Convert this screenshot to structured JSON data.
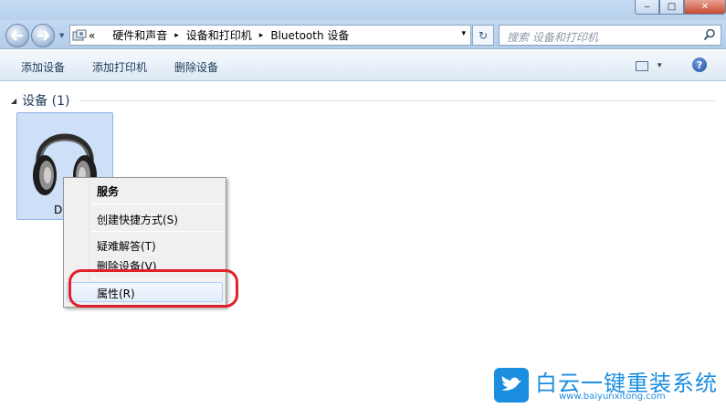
{
  "titlebar": {
    "min_label": "‒",
    "max_label": "□",
    "close_label": "✕"
  },
  "address": {
    "overflow": "«",
    "crumbs": [
      "硬件和声音",
      "设备和打印机",
      "Bluetooth 设备"
    ],
    "separator": "▸",
    "dropdown": "▾",
    "refresh": "↻"
  },
  "search": {
    "placeholder": "搜索 设备和打印机"
  },
  "commands": {
    "add_device": "添加设备",
    "add_printer": "添加打印机",
    "remove_device": "删除设备",
    "view_dropdown": "▾",
    "help": "?"
  },
  "group": {
    "arrow": "◢",
    "title": "设备 (1)"
  },
  "device": {
    "label": "Di"
  },
  "context_menu": {
    "items": [
      "服务",
      "创建快捷方式(S)",
      "疑难解答(T)",
      "删除设备(V)",
      "属性(R)"
    ]
  },
  "watermark": {
    "title": "白云一键重装系统",
    "url": "www.baiyunxitong.com"
  },
  "colors": {
    "accent": "#1c8ee0",
    "highlight_ring": "#e0202a"
  }
}
